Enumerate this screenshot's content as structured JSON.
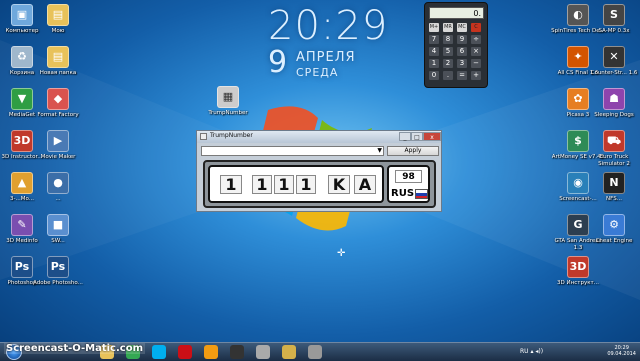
{
  "desktop": {
    "left_icons": [
      {
        "label": "Компьютер",
        "glyph": "▣",
        "color": "#6fa8dc"
      },
      {
        "label": "Мою",
        "glyph": "▤",
        "color": "#e8c25a"
      },
      {
        "label": "Корзина",
        "glyph": "♻",
        "color": "#9fb7cc"
      },
      {
        "label": "Новая папка",
        "glyph": "▤",
        "color": "#e8c25a"
      },
      {
        "label": "MediaGet",
        "glyph": "▼",
        "color": "#2f9e44"
      },
      {
        "label": "Format Factory",
        "glyph": "◆",
        "color": "#d9534f"
      },
      {
        "label": "3D Instructor...",
        "glyph": "3D",
        "color": "#c0392b"
      },
      {
        "label": "Movie Maker",
        "glyph": "▶",
        "color": "#4a7ab5"
      },
      {
        "label": "3-...Mo...",
        "glyph": "▲",
        "color": "#e0a030"
      },
      {
        "label": "...",
        "glyph": "●",
        "color": "#3b6ea8"
      },
      {
        "label": "3D Medinfo",
        "glyph": "✎",
        "color": "#7a4fb0"
      },
      {
        "label": "SW...",
        "glyph": "■",
        "color": "#5a8fcf"
      },
      {
        "label": "Photoshop",
        "glyph": "Ps",
        "color": "#1d4e89"
      },
      {
        "label": "Adobe Photosho...",
        "glyph": "Ps",
        "color": "#1d4e89"
      }
    ],
    "center_icon": {
      "label": "TrumpNumber",
      "glyph": "▦",
      "color": "#cccccc"
    },
    "right_icons": [
      {
        "label": "SpinTires Tech De...",
        "glyph": "◐",
        "color": "#555"
      },
      {
        "label": "SA-MP 0.3x",
        "glyph": "S",
        "color": "#444"
      },
      {
        "label": "All CS Final 1.6",
        "glyph": "✦",
        "color": "#d35400"
      },
      {
        "label": "Counter-Str... 1.6",
        "glyph": "✕",
        "color": "#333"
      },
      {
        "label": "Picasa 3",
        "glyph": "✿",
        "color": "#e67e22"
      },
      {
        "label": "Sleeping Dogs",
        "glyph": "☗",
        "color": "#8e44ad"
      },
      {
        "label": "ArtMoney SE v7.42",
        "glyph": "$",
        "color": "#2e8b57"
      },
      {
        "label": "Euro Truck Simulator 2",
        "glyph": "⛟",
        "color": "#c0392b"
      },
      {
        "label": "Screencast-...",
        "glyph": "◉",
        "color": "#2980b9"
      },
      {
        "label": "NFS...",
        "glyph": "N",
        "color": "#222"
      },
      {
        "label": "GTA San Andreas 1.3",
        "glyph": "G",
        "color": "#2c3e50"
      },
      {
        "label": "Cheat Engine",
        "glyph": "⚙",
        "color": "#3a7bd5"
      },
      {
        "label": "3D Инструкт...",
        "glyph": "3D",
        "color": "#c0392b"
      }
    ]
  },
  "clock": {
    "time": "20:29",
    "day": "9",
    "month": "АПРЕЛЯ",
    "weekday": "СРЕДА"
  },
  "calculator": {
    "display": "0.",
    "memory_keys": [
      "M+",
      "MR",
      "MC",
      "C"
    ],
    "keys": [
      "7",
      "8",
      "9",
      "÷",
      "4",
      "5",
      "6",
      "×",
      "1",
      "2",
      "3",
      "−",
      "0",
      ".",
      "=",
      "+"
    ]
  },
  "app": {
    "title": "TrumpNumber",
    "min_label": "_",
    "max_label": "□",
    "close_label": "x",
    "combo_value": "",
    "apply_label": "Apply",
    "plate": {
      "chars": [
        "1",
        "1",
        "1",
        "1",
        "K",
        "A"
      ],
      "region": "98",
      "country": "RUS"
    }
  },
  "taskbar": {
    "time": "20:29",
    "date": "09.04.2014",
    "tray": "RU ▴ ◂))",
    "apps": [
      {
        "name": "explorer",
        "color": "#e8c25a"
      },
      {
        "name": "chrome",
        "color": "#34a853"
      },
      {
        "name": "skype",
        "color": "#00aff0"
      },
      {
        "name": "opera",
        "color": "#cc0f16"
      },
      {
        "name": "media",
        "color": "#f39c12"
      },
      {
        "name": "screencast",
        "color": "#333"
      },
      {
        "name": "paint",
        "color": "#aaa"
      },
      {
        "name": "folder",
        "color": "#d4b04a"
      },
      {
        "name": "trumpnumber",
        "color": "#999"
      }
    ]
  },
  "watermark": "Screencast-O-Matic.com"
}
